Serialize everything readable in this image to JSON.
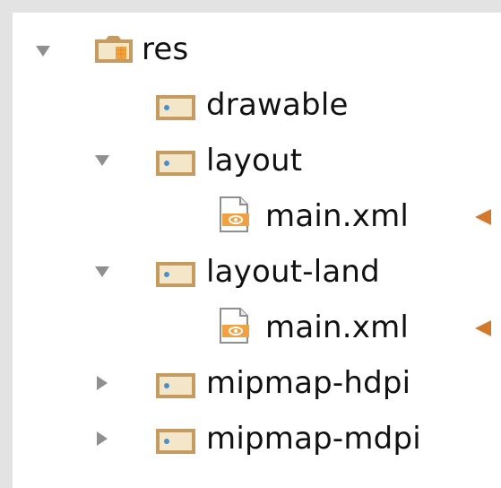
{
  "tree": {
    "root": {
      "label": "res",
      "expanded": true
    },
    "items": [
      {
        "label": "drawable",
        "type": "folder",
        "expanded": null
      },
      {
        "label": "layout",
        "type": "folder",
        "expanded": true
      },
      {
        "label": "main.xml",
        "type": "xml-file"
      },
      {
        "label": "layout-land",
        "type": "folder",
        "expanded": true
      },
      {
        "label": "main.xml",
        "type": "xml-file"
      },
      {
        "label": "mipmap-hdpi",
        "type": "folder",
        "expanded": false
      },
      {
        "label": "mipmap-mdpi",
        "type": "folder",
        "expanded": false
      }
    ]
  },
  "icons": {
    "folder": "folder-icon",
    "res_folder": "resource-folder-icon",
    "xml": "xml-layout-file-icon",
    "expand": "chevron-down-icon",
    "collapse": "chevron-right-icon",
    "pointer": "arrow-pointer-icon"
  },
  "colors": {
    "folder": "#c69b5f",
    "folder_dot": "#4a8fc6",
    "xml_accent": "#f0a142",
    "pointer_arrow": "#d3792e",
    "chevron": "#8f8f8f"
  }
}
